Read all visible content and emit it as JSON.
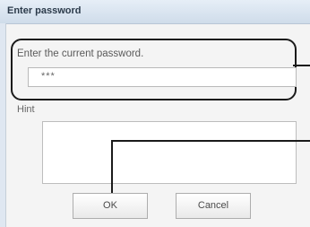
{
  "dialog": {
    "title": "Enter password",
    "prompt": "Enter the current password.",
    "password_value": "***",
    "hint_label": "Hint",
    "ok_label": "OK",
    "cancel_label": "Cancel"
  }
}
